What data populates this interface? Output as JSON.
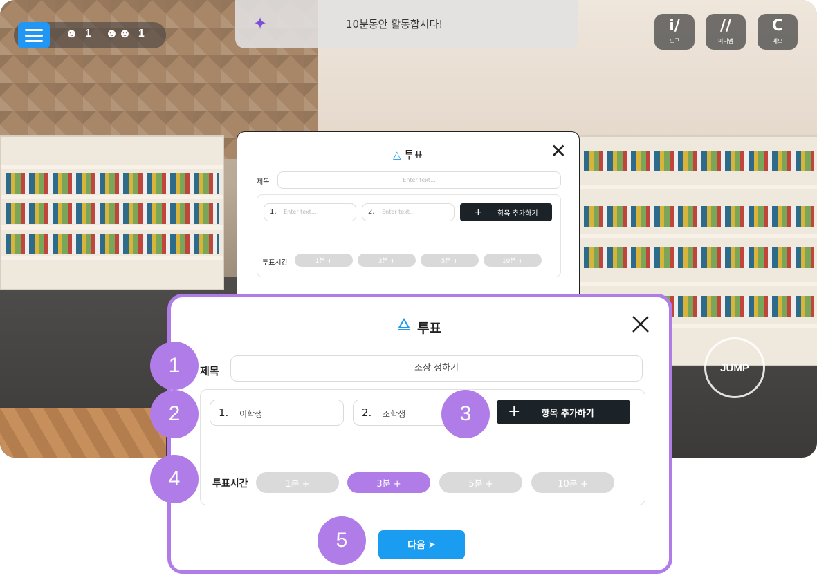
{
  "topbar": {
    "user_count": "1",
    "group_count": "1"
  },
  "notice": {
    "text": "10분동안 활동합시다!"
  },
  "tools": [
    {
      "label": "도구",
      "glyph": "i/"
    },
    {
      "label": "미니맵",
      "glyph": "//"
    },
    {
      "label": "메모",
      "glyph": "C"
    }
  ],
  "jump_label": "JUMP",
  "bg_modal": {
    "title": "투표",
    "title_label": "제목",
    "title_placeholder": "Enter text...",
    "option1_num": "1.",
    "option1_placeholder": "Enter text...",
    "option2_num": "2.",
    "option2_placeholder": "Enter text...",
    "add_label": "항목 추가하기",
    "time_label": "투표시간",
    "times": [
      "1분 +",
      "3분 +",
      "5분 +",
      "10분 +"
    ]
  },
  "modal": {
    "title": "투표",
    "title_label": "제목",
    "title_value": "조장 정하기",
    "option1_num": "1.",
    "option1_value": "이학생",
    "option2_num": "2.",
    "option2_value": "조학생",
    "add_label": "항목 추가하기",
    "time_label": "투표시간",
    "times": [
      "1분 +",
      "3분 +",
      "5분 +",
      "10분 +"
    ],
    "selected_time": "3분 +",
    "next_label": "다음"
  },
  "badges": [
    "1",
    "2",
    "3",
    "4",
    "5"
  ],
  "colors": {
    "accent_purple": "#b07ce8",
    "primary_blue": "#1a9cf0",
    "dark_button": "#1b2228"
  }
}
